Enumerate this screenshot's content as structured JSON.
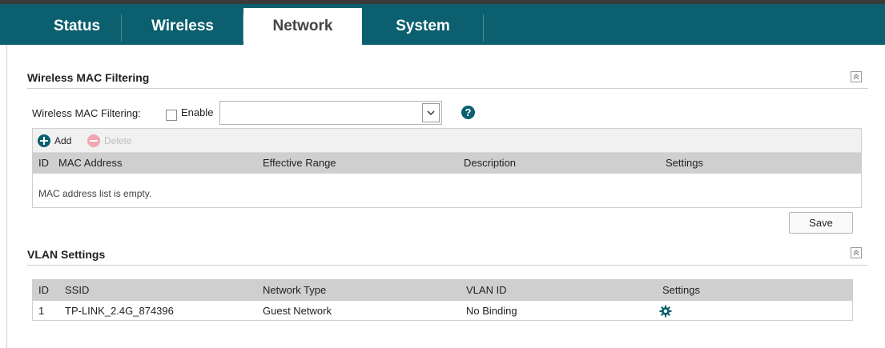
{
  "nav": {
    "tabs": [
      {
        "label": "Status"
      },
      {
        "label": "Wireless"
      },
      {
        "label": "Network",
        "active": true
      },
      {
        "label": "System"
      }
    ]
  },
  "mac_filtering": {
    "section_title": "Wireless MAC Filtering",
    "field_label": "Wireless MAC Filtering:",
    "enable_label": "Enable",
    "enabled": false,
    "select_value": "",
    "help_symbol": "?",
    "toolbar": {
      "add_label": "Add",
      "delete_label": "Delete"
    },
    "columns": [
      "ID",
      "MAC Address",
      "Effective Range",
      "Description",
      "Settings"
    ],
    "empty_message": "MAC address list is empty.",
    "save_label": "Save"
  },
  "vlan": {
    "section_title": "VLAN Settings",
    "columns": [
      "ID",
      "SSID",
      "Network Type",
      "VLAN ID",
      "Settings"
    ],
    "rows": [
      {
        "id": "1",
        "ssid": "TP-LINK_2.4G_874396",
        "network_type": "Guest Network",
        "vlan_id": "No Binding",
        "settings_icon": "gear-icon"
      }
    ]
  },
  "colors": {
    "nav_background": "#0b5f6e",
    "accent": "#0b5f6e",
    "delete_disabled": "#f2a5b2",
    "header_row": "#cfcfcf"
  }
}
